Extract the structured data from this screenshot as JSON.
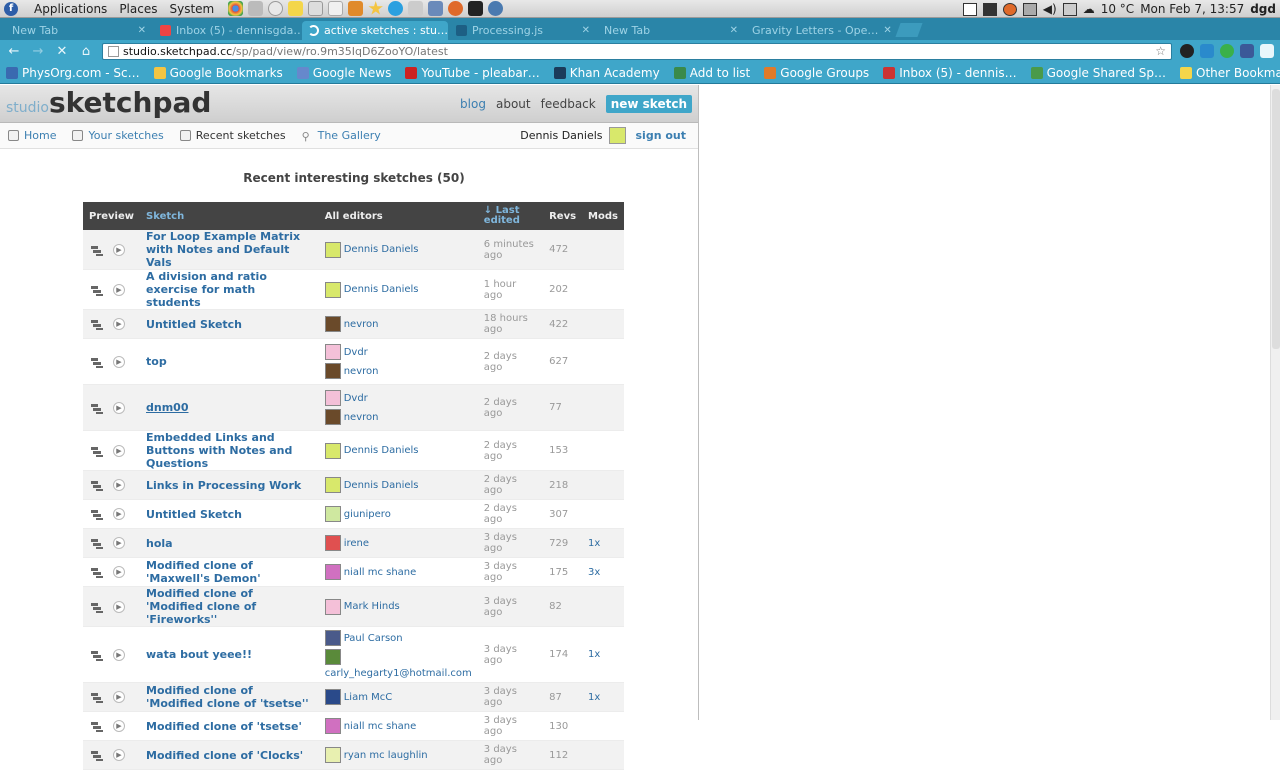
{
  "system": {
    "menus": [
      "Applications",
      "Places",
      "System"
    ],
    "weather": "10 °C",
    "clock": "Mon Feb  7, 13:57",
    "user": "dgd"
  },
  "tabs": [
    {
      "label": "New Tab",
      "active": false
    },
    {
      "label": "Inbox (5) - dennisgda…",
      "active": false
    },
    {
      "label": "active sketches : stu…",
      "active": true
    },
    {
      "label": "Processing.js",
      "active": false
    },
    {
      "label": "New Tab",
      "active": false
    },
    {
      "label": "Gravity Letters - Ope…",
      "active": false
    }
  ],
  "omnibox": {
    "host": "studio.sketchpad.cc",
    "path": "/sp/pad/view/ro.9m35IqD6ZooYO/latest"
  },
  "bookmarks": [
    {
      "label": "PhysOrg.com - Sc…",
      "color": "#3a6ab0"
    },
    {
      "label": "Google Bookmarks",
      "color": "#f4c542"
    },
    {
      "label": "Google News",
      "color": "#6688cc"
    },
    {
      "label": "YouTube - pleabar…",
      "color": "#cc2222"
    },
    {
      "label": "Khan Academy",
      "color": "#1b3b5a"
    },
    {
      "label": "Add to list",
      "color": "#3a8a4a"
    },
    {
      "label": "Google Groups",
      "color": "#e07a2a"
    },
    {
      "label": "Inbox (5) - dennis…",
      "color": "#cc3333"
    },
    {
      "label": "Google Shared Sp…",
      "color": "#4a9a4a"
    }
  ],
  "bookmark_other": "Other Bookmarks",
  "app": {
    "brand_studio": "studio",
    "brand_sketchpad": "sketchpad",
    "topnav": {
      "blog": "blog",
      "about": "about",
      "feedback": "feedback",
      "new_sketch": "new sketch"
    },
    "subnav": {
      "home": "Home",
      "your": "Your sketches",
      "recent": "Recent sketches",
      "gallery": "The Gallery"
    },
    "user_name": "Dennis Daniels",
    "sign_out": "sign out",
    "list_title": "Recent interesting sketches (50)"
  },
  "table": {
    "headers": {
      "preview": "Preview",
      "sketch": "Sketch",
      "editors": "All editors",
      "last_arrow": "↓ Last",
      "last_word": "edited",
      "revs": "Revs",
      "mods": "Mods"
    },
    "rows": [
      {
        "name": "For Loop Example Matrix with Notes and Default Vals",
        "editors": [
          {
            "name": "Dennis Daniels",
            "color": "#d8e86b"
          }
        ],
        "last": "6 minutes ago",
        "revs": "472",
        "mods": ""
      },
      {
        "name": "A division and ratio exercise for math students",
        "editors": [
          {
            "name": "Dennis Daniels",
            "color": "#d8e86b"
          }
        ],
        "last": "1 hour ago",
        "revs": "202",
        "mods": ""
      },
      {
        "name": "Untitled Sketch",
        "editors": [
          {
            "name": "nevron",
            "color": "#6a4a2a"
          }
        ],
        "last": "18 hours ago",
        "revs": "422",
        "mods": ""
      },
      {
        "name": "top",
        "editors": [
          {
            "name": "Dvdr",
            "color": "#f4c0d8"
          },
          {
            "name": "nevron",
            "color": "#6a4a2a"
          }
        ],
        "last": "2 days ago",
        "revs": "627",
        "mods": ""
      },
      {
        "name": "dnm00",
        "editors": [
          {
            "name": "Dvdr",
            "color": "#f4c0d8"
          },
          {
            "name": "nevron",
            "color": "#6a4a2a"
          }
        ],
        "last": "2 days ago",
        "revs": "77",
        "mods": ""
      },
      {
        "name": "Embedded Links and Buttons with Notes and Questions",
        "editors": [
          {
            "name": "Dennis Daniels",
            "color": "#d8e86b"
          }
        ],
        "last": "2 days ago",
        "revs": "153",
        "mods": ""
      },
      {
        "name": "Links in Processing Work",
        "editors": [
          {
            "name": "Dennis Daniels",
            "color": "#d8e86b"
          }
        ],
        "last": "2 days ago",
        "revs": "218",
        "mods": ""
      },
      {
        "name": "Untitled Sketch",
        "editors": [
          {
            "name": "giunipero",
            "color": "#cfe8a0"
          }
        ],
        "last": "2 days ago",
        "revs": "307",
        "mods": ""
      },
      {
        "name": "hola",
        "editors": [
          {
            "name": "irene",
            "color": "#e05050"
          }
        ],
        "last": "3 days ago",
        "revs": "729",
        "mods": "1x"
      },
      {
        "name": "Modified clone of 'Maxwell's Demon'",
        "editors": [
          {
            "name": "niall mc shane",
            "color": "#d070c0"
          }
        ],
        "last": "3 days ago",
        "revs": "175",
        "mods": "3x"
      },
      {
        "name": "Modified clone of 'Modified clone of 'Fireworks''",
        "editors": [
          {
            "name": "Mark Hinds",
            "color": "#f4c0d8"
          }
        ],
        "last": "3 days ago",
        "revs": "82",
        "mods": ""
      },
      {
        "name": "wata bout yeee!!",
        "editors": [
          {
            "name": "Paul Carson",
            "color": "#4a5a8a"
          },
          {
            "name": "carly_hegarty1@hotmail.com",
            "color": "#5a8a3a"
          }
        ],
        "last": "3 days ago",
        "revs": "174",
        "mods": "1x"
      },
      {
        "name": "Modified clone of 'Modified clone of 'tsetse''",
        "editors": [
          {
            "name": "Liam McC",
            "color": "#2a4a8a"
          }
        ],
        "last": "3 days ago",
        "revs": "87",
        "mods": "1x"
      },
      {
        "name": "Modified clone of 'tsetse'",
        "editors": [
          {
            "name": "niall mc shane",
            "color": "#d070c0"
          }
        ],
        "last": "3 days ago",
        "revs": "130",
        "mods": ""
      },
      {
        "name": "Modified clone of 'Clocks'",
        "editors": [
          {
            "name": "ryan mc laughlin",
            "color": "#e8f0b0"
          }
        ],
        "last": "3 days ago",
        "revs": "112",
        "mods": ""
      }
    ]
  }
}
